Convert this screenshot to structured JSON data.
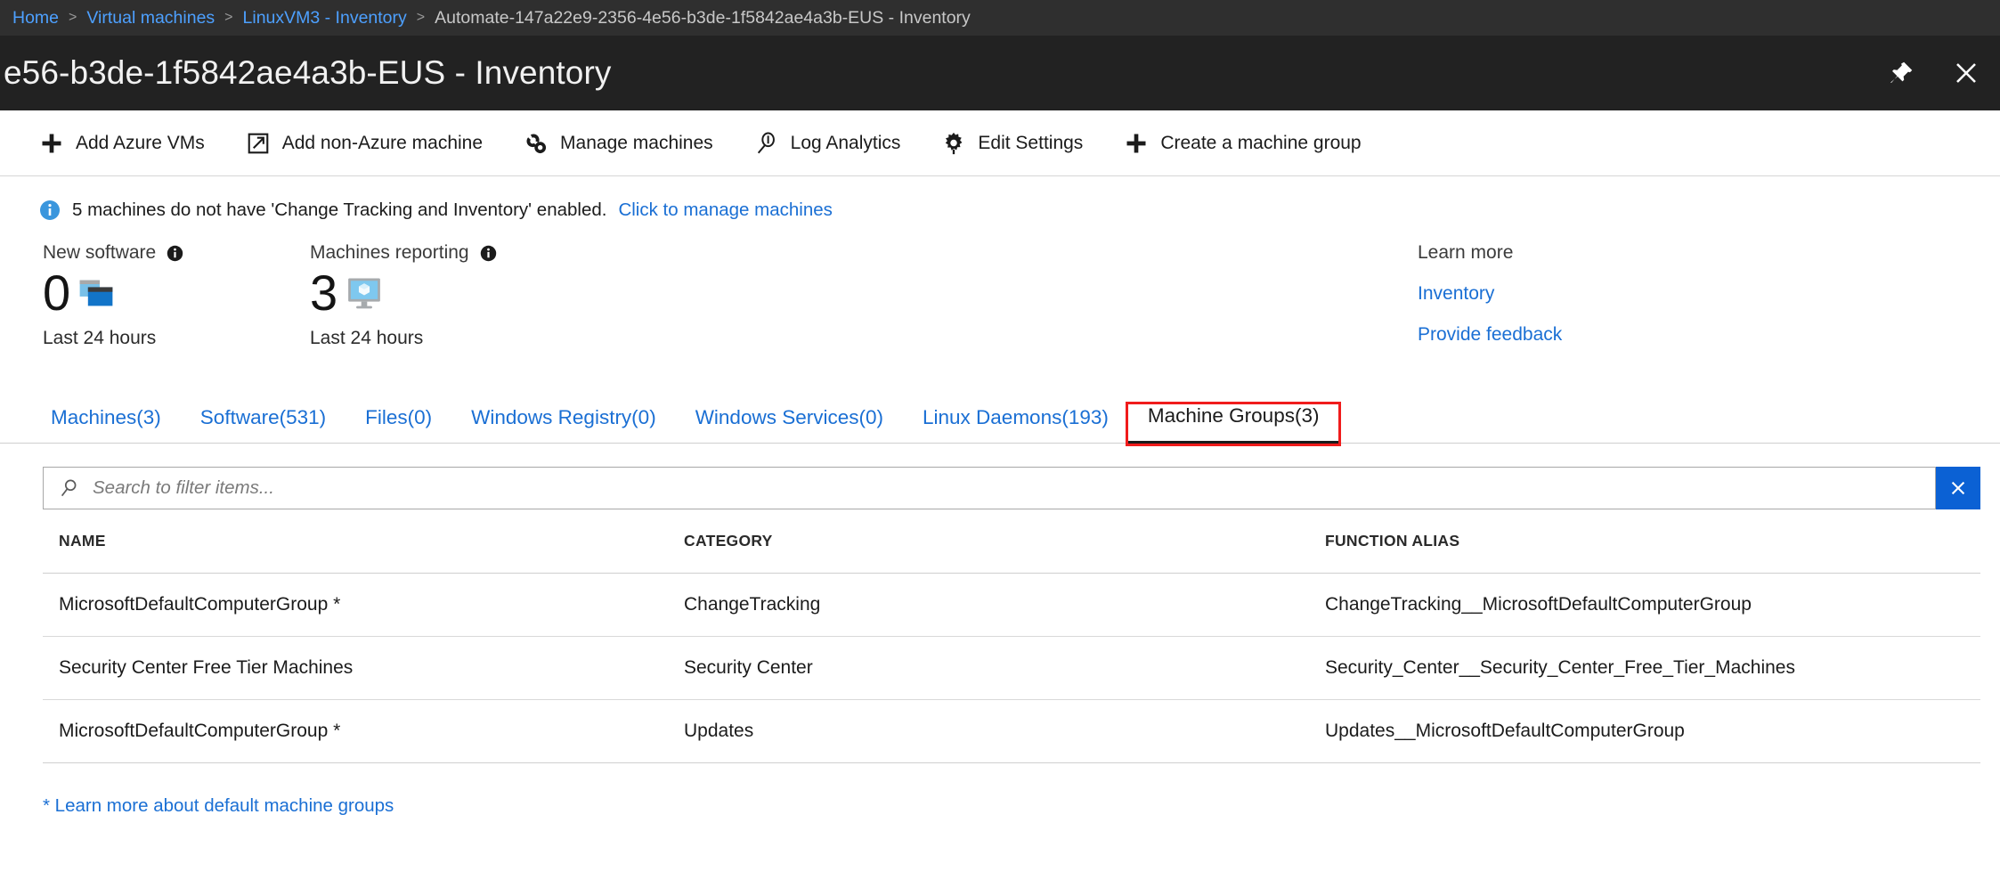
{
  "breadcrumb": {
    "items": [
      {
        "label": "Home",
        "current": false
      },
      {
        "label": "Virtual machines",
        "current": false
      },
      {
        "label": "LinuxVM3 - Inventory",
        "current": false
      },
      {
        "label": "Automate-147a22e9-2356-4e56-b3de-1f5842ae4a3b-EUS - Inventory",
        "current": true
      }
    ],
    "separator": ">"
  },
  "header": {
    "title": "e56-b3de-1f5842ae4a3b-EUS - Inventory",
    "pin_icon": "pin-icon",
    "close_icon": "close-icon"
  },
  "toolbar": {
    "items": [
      {
        "label": "Add Azure VMs",
        "icon": "plus-icon"
      },
      {
        "label": "Add non-Azure machine",
        "icon": "external-link-icon"
      },
      {
        "label": "Manage machines",
        "icon": "machines-icon"
      },
      {
        "label": "Log Analytics",
        "icon": "magnifier-icon"
      },
      {
        "label": "Edit Settings",
        "icon": "gear-icon"
      },
      {
        "label": "Create a machine group",
        "icon": "plus-icon"
      }
    ]
  },
  "info_banner": {
    "icon": "info-icon",
    "text": "5 machines do not have 'Change Tracking and Inventory' enabled.",
    "link": "Click to manage machines"
  },
  "stats": [
    {
      "label": "New software",
      "value": "0",
      "sublabel": "Last 24 hours",
      "icon": "software-windows-icon",
      "info_icon": "info-circle-icon"
    },
    {
      "label": "Machines reporting",
      "value": "3",
      "sublabel": "Last 24 hours",
      "icon": "monitor-cube-icon",
      "info_icon": "info-circle-icon"
    }
  ],
  "learn_more": {
    "title": "Learn more",
    "links": [
      "Inventory",
      "Provide feedback"
    ]
  },
  "tabs": [
    {
      "label": "Machines(3)",
      "active": false,
      "highlighted": false
    },
    {
      "label": "Software(531)",
      "active": false,
      "highlighted": false
    },
    {
      "label": "Files(0)",
      "active": false,
      "highlighted": false
    },
    {
      "label": "Windows Registry(0)",
      "active": false,
      "highlighted": false
    },
    {
      "label": "Windows Services(0)",
      "active": false,
      "highlighted": false
    },
    {
      "label": "Linux Daemons(193)",
      "active": false,
      "highlighted": false
    },
    {
      "label": "Machine Groups(3)",
      "active": true,
      "highlighted": true
    }
  ],
  "search": {
    "placeholder": "Search to filter items...",
    "value": "",
    "icon": "search-icon",
    "clear_label": "✕"
  },
  "table": {
    "columns": [
      "NAME",
      "CATEGORY",
      "FUNCTION ALIAS"
    ],
    "rows": [
      {
        "name": "MicrosoftDefaultComputerGroup *",
        "category": "ChangeTracking",
        "function_alias": "ChangeTracking__MicrosoftDefaultComputerGroup"
      },
      {
        "name": "Security Center Free Tier Machines",
        "category": "Security Center",
        "function_alias": "Security_Center__Security_Center_Free_Tier_Machines"
      },
      {
        "name": "MicrosoftDefaultComputerGroup *",
        "category": "Updates",
        "function_alias": "Updates__MicrosoftDefaultComputerGroup"
      }
    ]
  },
  "footnote": "* Learn more about default machine groups",
  "colors": {
    "header_dark": "#222222",
    "breadcrumb_dark": "#2f2f2f",
    "link_blue": "#1a6fd4",
    "accent_blue": "#0b61d4",
    "highlight_red": "#f01c1c"
  }
}
